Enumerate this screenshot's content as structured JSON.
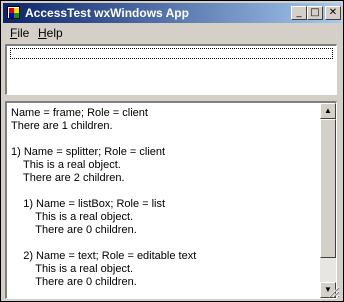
{
  "window": {
    "title": "AccessTest wxWindows App",
    "buttons": {
      "minimize": "_",
      "maximize": "□",
      "close": "✕"
    }
  },
  "menu": [
    {
      "label": "File",
      "accel": "F"
    },
    {
      "label": "Help",
      "accel": "H"
    }
  ],
  "listbox": {
    "items": [
      ""
    ]
  },
  "text_lines": [
    "Name = frame; Role = client",
    "There are 1 children.",
    "",
    "1) Name = splitter; Role = client",
    "    This is a real object.",
    "    There are 2 children.",
    "",
    "    1) Name = listBox; Role = list",
    "        This is a real object.",
    "        There are 0 children.",
    "",
    "    2) Name = text; Role = editable text",
    "        This is a real object.",
    "        There are 0 children."
  ],
  "scrollbar": {
    "up_arrow": "▲",
    "down_arrow": "▼",
    "thumb_fraction": 0.85
  }
}
